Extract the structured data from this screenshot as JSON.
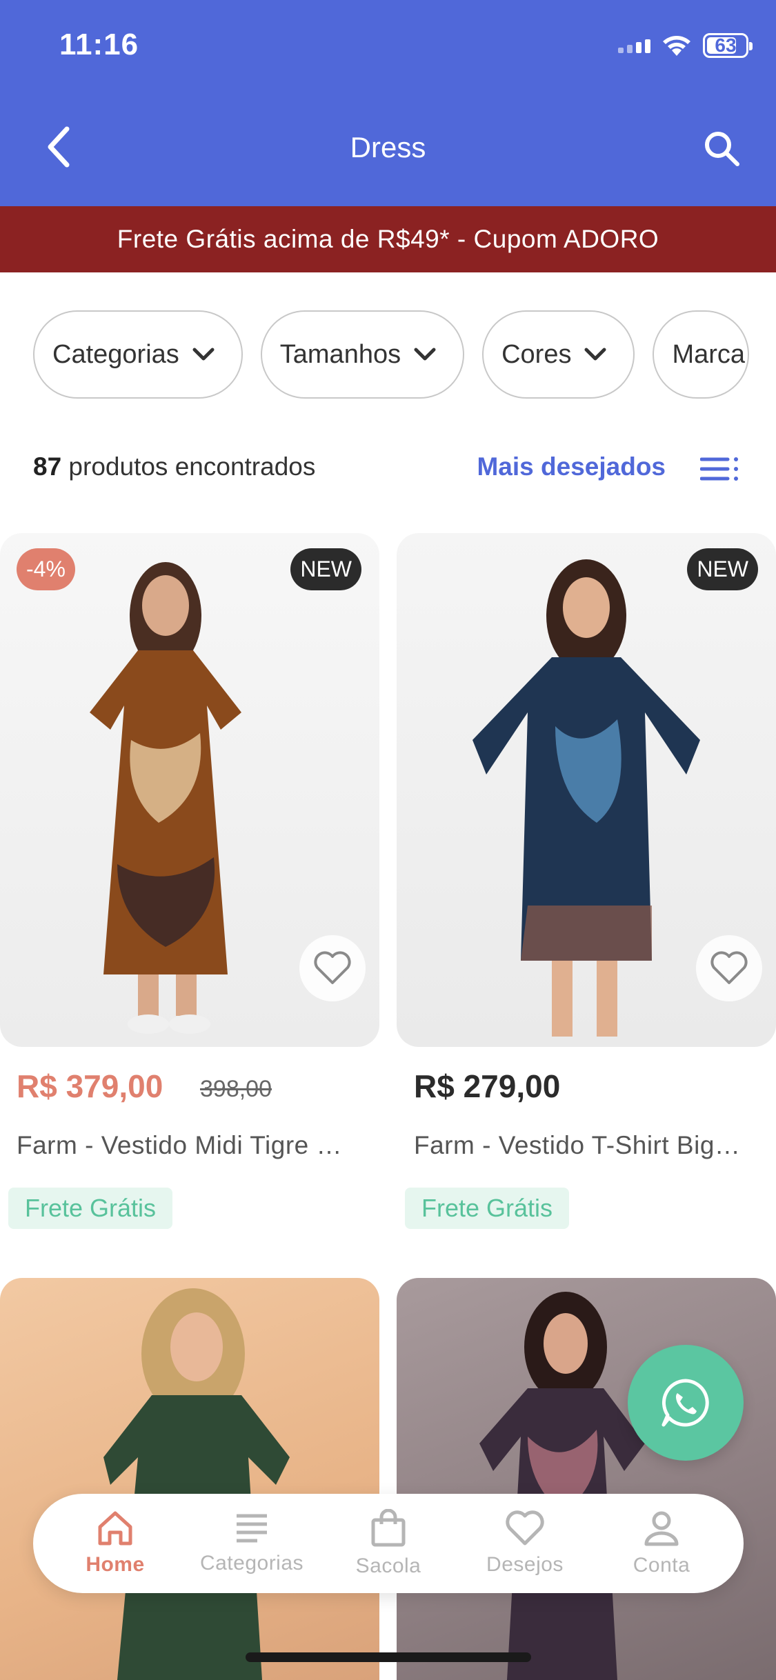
{
  "status_bar": {
    "time": "11:16",
    "battery": "63"
  },
  "header": {
    "title": "Dress"
  },
  "promo": {
    "text": "Frete Grátis acima de R$49* - Cupom ADORO"
  },
  "filters": [
    {
      "label": "Categorias"
    },
    {
      "label": "Tamanhos"
    },
    {
      "label": "Cores"
    },
    {
      "label": "Marca"
    }
  ],
  "results": {
    "count": "87",
    "text": " produtos encontrados",
    "sort_label": "Mais desejados"
  },
  "products": [
    {
      "badge_discount": "-4%",
      "badge_new": "NEW",
      "price": "R$ 379,00",
      "old_price": "398,00",
      "name": "Farm - Vestido Midi Tigre …",
      "shipping": "Frete Grátis",
      "price_color": "#E0806E"
    },
    {
      "badge_new": "NEW",
      "price": "R$ 279,00",
      "name": "Farm - Vestido T-Shirt Big…",
      "shipping": "Frete Grátis",
      "price_color": "#2b2b2b"
    }
  ],
  "bottom_nav": [
    {
      "label": "Home",
      "icon": "home-icon",
      "active": true
    },
    {
      "label": "Categorias",
      "icon": "menu-lines-icon",
      "active": false
    },
    {
      "label": "Sacola",
      "icon": "shopping-bag-icon",
      "active": false
    },
    {
      "label": "Desejos",
      "icon": "heart-icon",
      "active": false
    },
    {
      "label": "Conta",
      "icon": "user-icon",
      "active": false
    }
  ],
  "colors": {
    "header": "#5068D9",
    "promo": "#8B2222",
    "accent": "#E0806E",
    "whatsapp": "#5BC6A1"
  }
}
